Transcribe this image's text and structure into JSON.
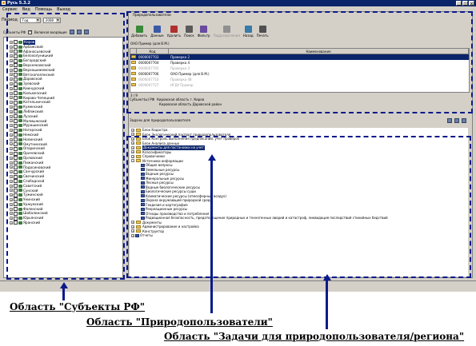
{
  "window": {
    "title": "Русь 5.3.2",
    "menu": [
      "Сервис",
      "Вид",
      "Помощь",
      "Выход"
    ]
  },
  "left_toolbar": {
    "year_label": "Период",
    "year_value": "Год",
    "year_number": "2008"
  },
  "left_panel": {
    "header": "Субъекты РФ",
    "checkbox_label": "Включая входящие",
    "items": [
      "Киров",
      "Арбажский",
      "Афанасьевский",
      "Белохолуницкий",
      "Богородский",
      "Верхнекамский",
      "Верхошижемский",
      "Вятскополянский",
      "Даровской",
      "Зуевский",
      "Кикнурский",
      "Кильмезский",
      "Кирово-Чепецкий",
      "Котельничский",
      "Куменский",
      "Лебяжский",
      "Лузский",
      "Малмыжский",
      "Мурашинский",
      "Нагорский",
      "Немский",
      "Нолинский",
      "Омутнинский",
      "Опаринский",
      "Оричевский",
      "Орловский",
      "Пижанский",
      "Подосиновский",
      "Санчурский",
      "Свечинский",
      "Слободской",
      "Советский",
      "Сунский",
      "Тужинский",
      "Унинский",
      "Уржумский",
      "Фаленский",
      "Шабалинский",
      "Юрьянский",
      "Яранский"
    ]
  },
  "right_toolbar": {
    "tab_label": "Природопользователи",
    "buttons": [
      {
        "label": "Добавить",
        "disabled": false
      },
      {
        "label": "Данные",
        "disabled": false
      },
      {
        "label": "Удалить",
        "disabled": false
      },
      {
        "label": "Поиск",
        "disabled": false
      },
      {
        "label": "Фильтр",
        "disabled": false
      },
      {
        "label": "Подразделения",
        "disabled": true
      },
      {
        "label": "Назад",
        "disabled": false
      },
      {
        "label": "Печать",
        "disabled": false
      }
    ]
  },
  "grid": {
    "caption": "ОАО Пример (для В.М.)",
    "columns": [
      "Код",
      "Наименование"
    ],
    "rows": [
      {
        "code": "0000007703",
        "name": "Проверка 2",
        "state": "sel"
      },
      {
        "code": "0000007704",
        "name": "Проверка 4",
        "state": ""
      },
      {
        "code": "0000007705",
        "name": "Проверка 3",
        "state": "dim"
      },
      {
        "code": "0000007706",
        "name": "ОАО Пример (для В.М.)",
        "state": ""
      },
      {
        "code": "0000007710",
        "name": "Проверка 48",
        "state": "dim"
      },
      {
        "code": "0000007727",
        "name": "НГДУ Пример",
        "state": "dim"
      }
    ],
    "counter": "3 / 9"
  },
  "info": {
    "label": "Субъект(ы) РФ",
    "line1": "Кировская область г. Киров",
    "line2": "Кировская область Даровской район"
  },
  "tasks": {
    "header": "Задачи для природопользователя",
    "items": [
      {
        "text": "Блок Кадастра",
        "level": 0,
        "kind": "folder",
        "sel": false
      },
      {
        "text": "Блок Экологический паспорт природопользователя",
        "level": 0,
        "kind": "folder",
        "sel": false
      },
      {
        "text": "Блок Контроль выполнения предписаний, учет проверок",
        "level": 0,
        "kind": "folder",
        "sel": false
      },
      {
        "text": "Блок Анализа данных",
        "level": 0,
        "kind": "folder",
        "sel": false
      },
      {
        "text": "Документы для постановки на учет",
        "level": 0,
        "kind": "folder",
        "sel": true
      },
      {
        "text": "Классификаторы",
        "level": 0,
        "kind": "folder",
        "sel": false
      },
      {
        "text": "Справочники",
        "level": 0,
        "kind": "folder",
        "sel": false
      },
      {
        "text": "Источники информации",
        "level": 0,
        "kind": "folder",
        "sel": false
      },
      {
        "text": "Общие вопросы",
        "level": 1,
        "kind": "book",
        "sel": false
      },
      {
        "text": "Земельные ресурсы",
        "level": 1,
        "kind": "book",
        "sel": false
      },
      {
        "text": "Водные ресурсы",
        "level": 1,
        "kind": "book",
        "sel": false
      },
      {
        "text": "Минеральные ресурсы",
        "level": 1,
        "kind": "book",
        "sel": false
      },
      {
        "text": "Лесные ресурсы",
        "level": 1,
        "kind": "book",
        "sel": false
      },
      {
        "text": "Водные биологические ресурсы",
        "level": 1,
        "kind": "book",
        "sel": false
      },
      {
        "text": "Биологические ресурсы суши",
        "level": 1,
        "kind": "book",
        "sel": false
      },
      {
        "text": "Климатические ресурсы (атмосферный воздух)",
        "level": 1,
        "kind": "book",
        "sel": false
      },
      {
        "text": "Охрана окружающей природной среды",
        "level": 1,
        "kind": "book",
        "sel": false
      },
      {
        "text": "Геодезия и картография",
        "level": 1,
        "kind": "book",
        "sel": false
      },
      {
        "text": "Рекреационные ресурсы",
        "level": 1,
        "kind": "book",
        "sel": false
      },
      {
        "text": "Отходы производства и потребления",
        "level": 1,
        "kind": "book",
        "sel": false
      },
      {
        "text": "Радиационная безопасность, предотвращение природных и техногенных аварий и катастроф, ликвидация последствий стихийных бедствий",
        "level": 1,
        "kind": "book",
        "sel": false
      },
      {
        "text": "Документы",
        "level": 0,
        "kind": "folder",
        "sel": false
      },
      {
        "text": "Администрирование и настройка",
        "level": 0,
        "kind": "folder",
        "sel": false
      },
      {
        "text": "Конструктор",
        "level": 0,
        "kind": "folder",
        "sel": false
      },
      {
        "text": "Отчеты",
        "level": 0,
        "kind": "book",
        "sel": false
      }
    ]
  },
  "captions": {
    "subjects": "Область \"Субъекты РФ\"",
    "users": "Область \"Природопользователи\"",
    "tasks": "Область \"Задачи для природопользователя/региона\""
  }
}
